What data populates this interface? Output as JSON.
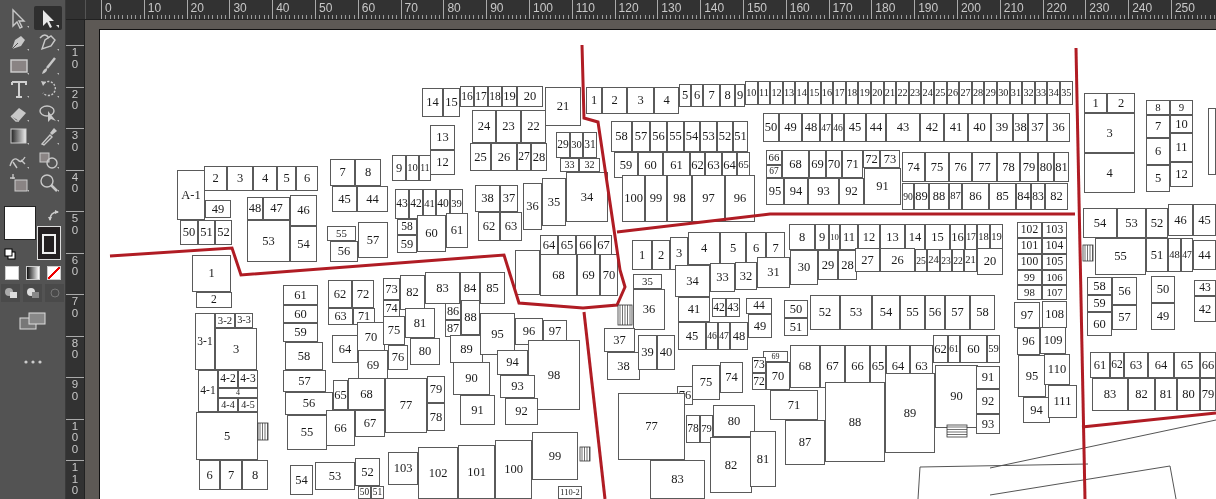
{
  "toolbar": {
    "tools": [
      {
        "selected": false
      },
      {
        "selected": true
      },
      {
        "selected": false
      },
      {
        "selected": false
      },
      {
        "selected": false
      },
      {
        "selected": false
      },
      {
        "selected": false
      },
      {
        "selected": false
      },
      {
        "selected": false
      },
      {
        "selected": false
      },
      {
        "selected": false
      },
      {
        "selected": false
      },
      {
        "selected": false
      },
      {
        "selected": false
      },
      {
        "selected": false
      },
      {
        "selected": false
      }
    ]
  },
  "top_ruler": {
    "labels": [
      "0",
      "10",
      "20",
      "30",
      "40",
      "50",
      "60",
      "70",
      "80",
      "90",
      "100",
      "110",
      "120",
      "130",
      "140",
      "150",
      "160",
      "170",
      "180",
      "190",
      "200",
      "210",
      "220",
      "230",
      "240",
      "250"
    ]
  },
  "left_ruler": {
    "labels": [
      "10",
      "20",
      "30",
      "40",
      "50",
      "60",
      "70",
      "80",
      "90",
      "100",
      "110"
    ]
  },
  "map": {
    "lots": [
      "A-1",
      "2",
      "3",
      "4",
      "5",
      "6",
      "49",
      "48",
      "47",
      "46",
      "50",
      "51",
      "52",
      "53",
      "54",
      "7",
      "8",
      "45",
      "44",
      "55",
      "56",
      "57",
      "9",
      "10",
      "11",
      "13",
      "12",
      "14",
      "15",
      "16",
      "17",
      "18",
      "19",
      "20",
      "21",
      "24",
      "23",
      "22",
      "25",
      "26",
      "27",
      "28",
      "29",
      "30",
      "31",
      "33",
      "32",
      "34",
      "35",
      "36",
      "38",
      "37",
      "62",
      "63",
      "43",
      "42",
      "41",
      "40",
      "39",
      "58",
      "59",
      "60",
      "61",
      "64",
      "65",
      "66",
      "67",
      "68",
      "69",
      "70",
      "1",
      "2",
      "3",
      "4",
      "5",
      "6",
      "7",
      "8",
      "9",
      "10",
      "11",
      "12",
      "13",
      "14",
      "15",
      "16",
      "17",
      "18",
      "19",
      "20",
      "21",
      "22",
      "23",
      "24",
      "25",
      "26",
      "27",
      "28",
      "29",
      "30",
      "31",
      "32",
      "33",
      "34",
      "35",
      "50",
      "49",
      "48",
      "47",
      "46",
      "45",
      "44",
      "43",
      "42",
      "41",
      "40",
      "39",
      "38",
      "37",
      "36",
      "58",
      "57",
      "56",
      "55",
      "54",
      "53",
      "52",
      "51",
      "59",
      "60",
      "61",
      "62",
      "63",
      "64",
      "65",
      "100",
      "99",
      "98",
      "97",
      "96",
      "66",
      "67",
      "68",
      "69",
      "70",
      "71",
      "72",
      "73",
      "95",
      "94",
      "93",
      "92",
      "91",
      "74",
      "75",
      "76",
      "77",
      "78",
      "79",
      "80",
      "81",
      "90",
      "89",
      "88",
      "87",
      "86",
      "85",
      "84",
      "83",
      "82",
      "1",
      "2",
      "3",
      "4",
      "8",
      "9",
      "7",
      "6",
      "5",
      "10",
      "11",
      "12",
      "54",
      "53",
      "52",
      "46",
      "45",
      "55",
      "51",
      "48",
      "47",
      "44",
      "58",
      "59",
      "60",
      "56",
      "57",
      "50",
      "49",
      "43",
      "42",
      "61",
      "62",
      "63",
      "64",
      "65",
      "66",
      "83",
      "82",
      "81",
      "80",
      "79",
      "102",
      "101",
      "100",
      "99",
      "98",
      "103",
      "104",
      "105",
      "106",
      "107",
      "97",
      "108",
      "96",
      "109",
      "95",
      "110",
      "94",
      "111",
      "1",
      "2",
      "3",
      "4",
      "5",
      "6",
      "7",
      "8",
      "9",
      "10",
      "11",
      "12",
      "13",
      "14",
      "15",
      "16",
      "17",
      "18",
      "19",
      "34",
      "33",
      "32",
      "31",
      "30",
      "29",
      "28",
      "27",
      "26",
      "25",
      "24",
      "23",
      "22",
      "21",
      "20",
      "35",
      "36",
      "37",
      "38",
      "39",
      "40",
      "41",
      "42",
      "43",
      "44",
      "45",
      "46",
      "47",
      "48",
      "49",
      "50",
      "51",
      "52",
      "53",
      "54",
      "55",
      "56",
      "57",
      "58",
      "69",
      "70",
      "68",
      "67",
      "66",
      "65",
      "64",
      "63",
      "62",
      "61",
      "60",
      "59",
      "76",
      "75",
      "74",
      "73",
      "72",
      "77",
      "83",
      "78",
      "79",
      "80",
      "82",
      "81",
      "71",
      "87",
      "88",
      "89",
      "90",
      "91",
      "92",
      "93",
      "1",
      "2",
      "3-1",
      "3-2",
      "3-3",
      "3",
      "4-1",
      "4-2",
      "4-3",
      "4",
      "4-4",
      "4-5",
      "5",
      "6",
      "7",
      "8",
      "61",
      "60",
      "59",
      "58",
      "57",
      "56",
      "55",
      "62",
      "72",
      "63",
      "71",
      "64",
      "70",
      "69",
      "73",
      "74",
      "75",
      "76",
      "82",
      "83",
      "84",
      "85",
      "81",
      "80",
      "86",
      "87",
      "88",
      "89",
      "95",
      "96",
      "97",
      "98",
      "94",
      "93",
      "92",
      "90",
      "91",
      "65",
      "68",
      "66",
      "67",
      "77",
      "79",
      "78",
      "54",
      "53",
      "52",
      "50",
      "51",
      "103",
      "102",
      "101",
      "100",
      "99",
      "110-2"
    ]
  }
}
